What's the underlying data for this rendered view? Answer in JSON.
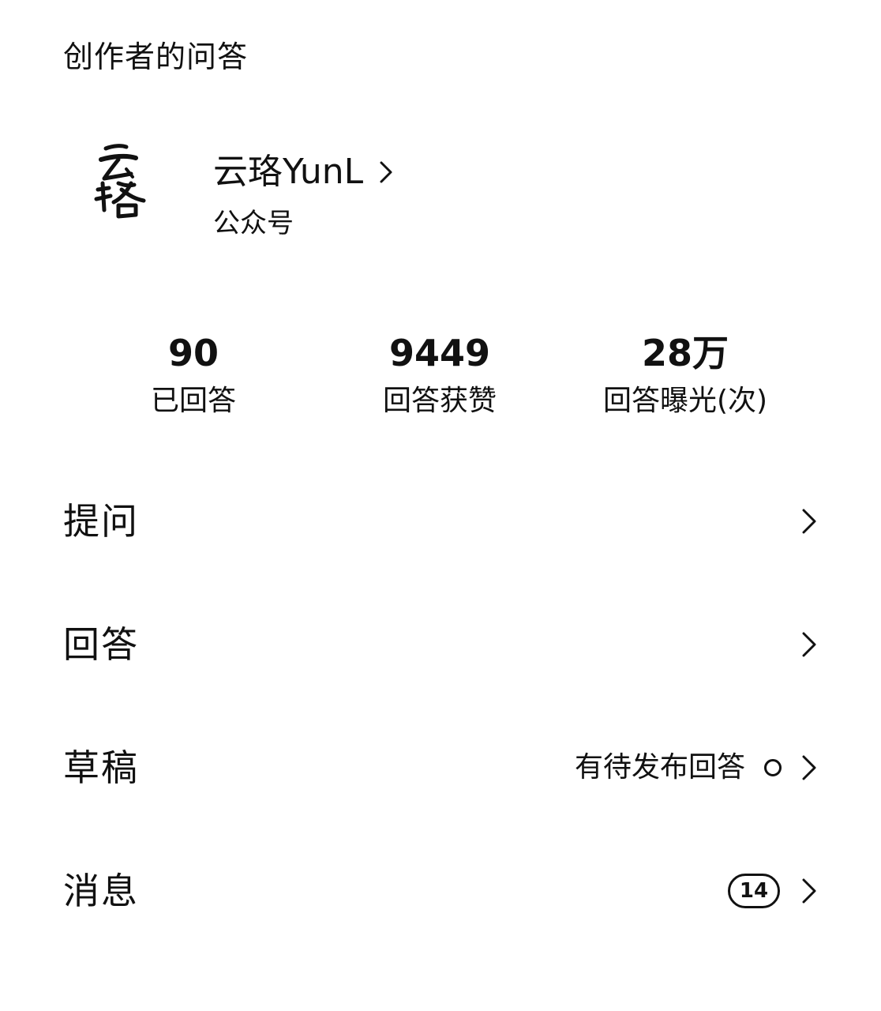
{
  "header": {
    "title": "创作者的问答"
  },
  "profile": {
    "avatar_text": "云珞",
    "name": "云珞YunL",
    "type": "公众号",
    "icons": {
      "chevron": "chevron-right-icon"
    }
  },
  "stats": [
    {
      "value": "90",
      "label": "已回答"
    },
    {
      "value": "9449",
      "label": "回答获赞"
    },
    {
      "value": "28万",
      "label": "回答曝光(次)"
    }
  ],
  "menu": {
    "items": [
      {
        "label": "提问",
        "note": "",
        "badge": ""
      },
      {
        "label": "回答",
        "note": "",
        "badge": ""
      },
      {
        "label": "草稿",
        "note": "有待发布回答",
        "badge": ""
      },
      {
        "label": "消息",
        "note": "",
        "badge": "14"
      }
    ]
  },
  "colors": {
    "text": "#111111",
    "background": "#ffffff"
  }
}
